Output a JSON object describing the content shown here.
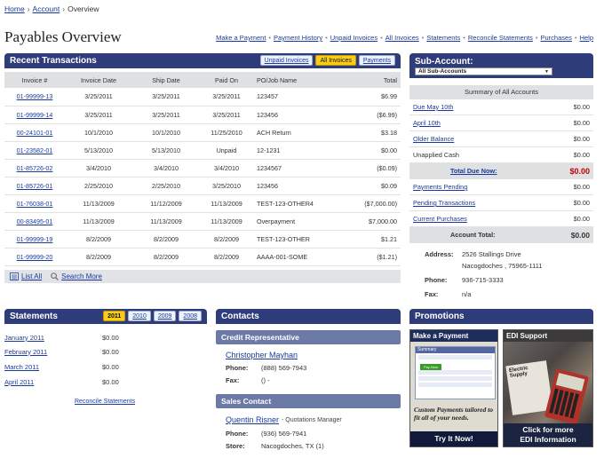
{
  "breadcrumb": {
    "home": "Home",
    "account": "Account",
    "current": "Overview",
    "sep": "›"
  },
  "page_title": "Payables Overview",
  "topnav": [
    "Make a Payment",
    "Payment History",
    "Unpaid Invoices",
    "All Invoices",
    "Statements",
    "Reconcile Statements",
    "Purchases",
    "Help"
  ],
  "recent": {
    "title": "Recent Transactions",
    "tabs": [
      "Unpaid Invoices",
      "All Invoices",
      "Payments"
    ],
    "active_tab": "All Invoices",
    "columns": [
      "Invoice #",
      "Invoice Date",
      "Ship Date",
      "Paid On",
      "PO/Job Name",
      "Total"
    ],
    "rows": [
      {
        "inv": "01-99999-13",
        "date": "3/25/2011",
        "ship": "3/25/2011",
        "paid": "3/25/2011",
        "po": "123457",
        "total": "$6.99"
      },
      {
        "inv": "01-99999-14",
        "date": "3/25/2011",
        "ship": "3/25/2011",
        "paid": "3/25/2011",
        "po": "123456",
        "total": "($6.99)"
      },
      {
        "inv": "00-24101-01",
        "date": "10/1/2010",
        "ship": "10/1/2010",
        "paid": "11/25/2010",
        "po": "ACH Return",
        "total": "$3.18"
      },
      {
        "inv": "01-23582-01",
        "date": "5/13/2010",
        "ship": "5/13/2010",
        "paid": "Unpaid",
        "po": "12-1231",
        "total": "$0.00"
      },
      {
        "inv": "01-85726-02",
        "date": "3/4/2010",
        "ship": "3/4/2010",
        "paid": "3/4/2010",
        "po": "1234567",
        "total": "($0.09)"
      },
      {
        "inv": "01-85726-01",
        "date": "2/25/2010",
        "ship": "2/25/2010",
        "paid": "3/25/2010",
        "po": "123456",
        "total": "$0.09"
      },
      {
        "inv": "01-76038-01",
        "date": "11/13/2009",
        "ship": "11/12/2009",
        "paid": "11/13/2009",
        "po": "TEST-123-OTHER4",
        "total": "($7,000.00)"
      },
      {
        "inv": "00-83495-01",
        "date": "11/13/2009",
        "ship": "11/13/2009",
        "paid": "11/13/2009",
        "po": "Overpayment",
        "total": "$7,000.00"
      },
      {
        "inv": "01-99999-19",
        "date": "8/2/2009",
        "ship": "8/2/2009",
        "paid": "8/2/2009",
        "po": "TEST-123-OTHER",
        "total": "$1.21"
      },
      {
        "inv": "01-99999-20",
        "date": "8/2/2009",
        "ship": "8/2/2009",
        "paid": "8/2/2009",
        "po": "AAAA-001-SOME",
        "total": "($1.21)"
      }
    ],
    "list_all": "List All",
    "search_more": "Search More"
  },
  "subaccount": {
    "title": "Sub-Account:",
    "selected": "All Sub-Accounts",
    "summary_title": "Summary of All Accounts",
    "rows": [
      {
        "label": "Due May 10th",
        "value": "$0.00",
        "link": true
      },
      {
        "label": "April 10th",
        "value": "$0.00",
        "link": true
      },
      {
        "label": "Older Balance",
        "value": "$0.00",
        "link": true
      },
      {
        "label": "Unapplied Cash",
        "value": "$0.00",
        "link": false
      }
    ],
    "total_due_label": "Total Due Now:",
    "total_due_value": "$0.00",
    "rows2": [
      {
        "label": "Payments Pending",
        "value": "$0.00"
      },
      {
        "label": "Pending Transactions",
        "value": "$0.00"
      },
      {
        "label": "Current Purchases",
        "value": "$0.00"
      }
    ],
    "account_total_label": "Account Total:",
    "account_total_value": "$0.00",
    "address_label": "Address:",
    "address_line1": "2526 Stallings Drive",
    "address_line2": "Nacogdoches , 75965-1111",
    "phone_label": "Phone:",
    "phone": "936-715-3333",
    "fax_label": "Fax:",
    "fax": "n/a"
  },
  "statements": {
    "title": "Statements",
    "years": [
      "2011",
      "2010",
      "2009",
      "2008"
    ],
    "active_year": "2011",
    "rows": [
      {
        "month": "January 2011",
        "value": "$0.00"
      },
      {
        "month": "February 2011",
        "value": "$0.00"
      },
      {
        "month": "March 2011",
        "value": "$0.00"
      },
      {
        "month": "April 2011",
        "value": "$0.00"
      }
    ],
    "reconcile": "Reconcile Statements"
  },
  "contacts": {
    "title": "Contacts",
    "credit": {
      "heading": "Credit Representative",
      "name": "Christopher Mayhan",
      "phone_label": "Phone:",
      "phone": "(888) 569-7943",
      "fax_label": "Fax:",
      "fax": "() -"
    },
    "sales": {
      "heading": "Sales Contact",
      "name": "Quentin Risner",
      "role": "- Quotations Manager",
      "phone_label": "Phone:",
      "phone": "(936) 569-7941",
      "store_label": "Store:",
      "store": "Nacogdoches, TX (1)"
    }
  },
  "promotions": {
    "title": "Promotions",
    "promo1": {
      "title": "Make a Payment",
      "tagline": "Custom Payments tailored to fit all of your needs.",
      "cta": "Try It Now!",
      "mini_header": "Summary",
      "mini_button": "Pay Now"
    },
    "promo2": {
      "title": "EDI Support",
      "card_text": "Electric Supply",
      "cta_line1": "Click for more",
      "cta_line2": "EDI Information"
    }
  }
}
